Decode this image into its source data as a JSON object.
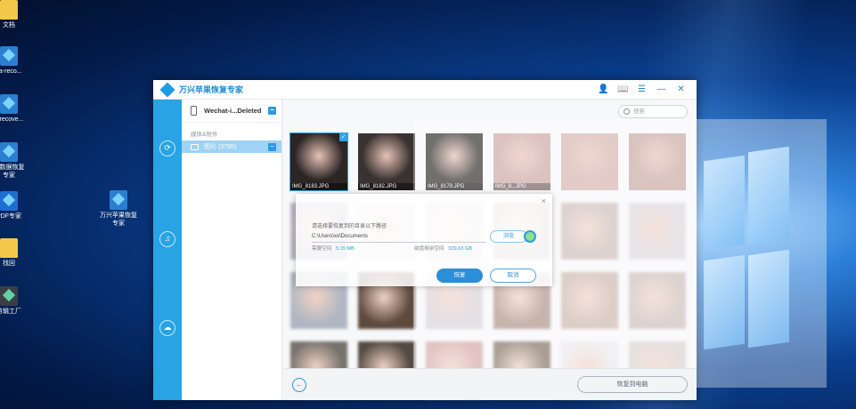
{
  "desktop": {
    "icons": [
      {
        "label": "文档",
        "kind": "folder"
      },
      {
        "label": "ita-reco...",
        "kind": "app"
      },
      {
        "label": "s-recove...",
        "kind": "app"
      },
      {
        "label": "兴数据恢复\n专家",
        "kind": "app"
      },
      {
        "label": "PDF专家",
        "kind": "pdf"
      },
      {
        "label": "找回",
        "kind": "folder"
      },
      {
        "label": "剪辑工厂",
        "kind": "app-dark"
      },
      {
        "label": "万兴苹果恢复\n专家",
        "kind": "app"
      }
    ]
  },
  "window": {
    "title": "万兴苹果恢复专家",
    "controls": {
      "user": "👤",
      "book": "📖",
      "menu": "☰",
      "minimize": "—",
      "close": "✕"
    }
  },
  "sidebar": {
    "icons": [
      "phone-sync-icon",
      "music-icon",
      "cloud-icon"
    ]
  },
  "tree": {
    "device": "Wechat-i...Deleted",
    "group_label": "媒体&附件",
    "items": [
      {
        "label": "图片 (3795)",
        "selected": true
      }
    ]
  },
  "search": {
    "placeholder": "搜索"
  },
  "photos": [
    {
      "caption": "IMG_8183.JPG",
      "selected": true,
      "color": "#2b2524"
    },
    {
      "caption": "IMG_8182.JPG",
      "selected": false,
      "color": "#3a3230"
    },
    {
      "caption": "IMG_8179.JPG",
      "selected": false,
      "color": "#27241f"
    },
    {
      "caption": "IMG_8...JPG",
      "selected": false,
      "color": "#c9a4a2"
    },
    {
      "caption": "",
      "selected": false,
      "color": "#d3b0ab"
    },
    {
      "caption": "",
      "selected": false,
      "color": "#c7a59f"
    }
  ],
  "dialog": {
    "prompt": "请选择要恢复到的目录以下路径",
    "path": "C:\\Users\\xx\\Documents",
    "browse": "浏览",
    "needed_label": "需要空间",
    "needed_value": "5.15 MB",
    "free_label": "磁盘剩余空间",
    "free_value": "329.63 GB",
    "ok": "恢复",
    "cancel": "取消",
    "close": "×"
  },
  "bottom": {
    "back": "←",
    "export": "恢复到电脑"
  },
  "colors": {
    "accent": "#28a3e3",
    "primary_button": "#2a8ed8"
  }
}
